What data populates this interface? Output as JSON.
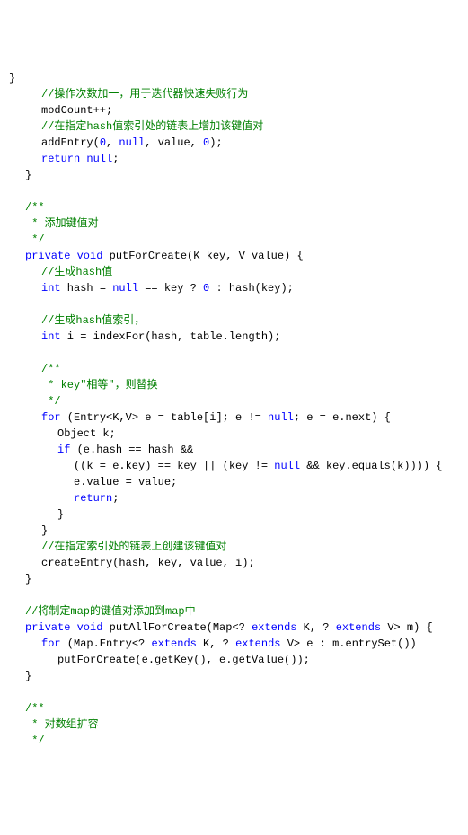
{
  "lines": [
    {
      "indent": 0,
      "spans": [
        {
          "t": "}",
          "c": "nm"
        }
      ]
    },
    {
      "indent": 2,
      "spans": [
        {
          "t": "//操作次数加一，用于迭代器快速失败行为",
          "c": "cm"
        }
      ]
    },
    {
      "indent": 2,
      "spans": [
        {
          "t": "modCount++;",
          "c": "nm"
        }
      ]
    },
    {
      "indent": 2,
      "spans": [
        {
          "t": "//在指定hash值索引处的链表上增加该键值对",
          "c": "cm"
        }
      ]
    },
    {
      "indent": 2,
      "spans": [
        {
          "t": "addEntry(",
          "c": "nm"
        },
        {
          "t": "0",
          "c": "kw"
        },
        {
          "t": ", ",
          "c": "nm"
        },
        {
          "t": "null",
          "c": "kw"
        },
        {
          "t": ", value, ",
          "c": "nm"
        },
        {
          "t": "0",
          "c": "kw"
        },
        {
          "t": ");",
          "c": "nm"
        }
      ]
    },
    {
      "indent": 2,
      "spans": [
        {
          "t": "return null",
          "c": "kw"
        },
        {
          "t": ";",
          "c": "nm"
        }
      ]
    },
    {
      "indent": 1,
      "spans": [
        {
          "t": "}",
          "c": "nm"
        }
      ]
    },
    {
      "indent": 0,
      "spans": [
        {
          "t": " ",
          "c": "nm"
        }
      ]
    },
    {
      "indent": 1,
      "spans": [
        {
          "t": "/**",
          "c": "cm"
        }
      ]
    },
    {
      "indent": 1,
      "spans": [
        {
          "t": " * 添加键值对",
          "c": "cm"
        }
      ]
    },
    {
      "indent": 1,
      "spans": [
        {
          "t": " */",
          "c": "cm"
        }
      ]
    },
    {
      "indent": 1,
      "spans": [
        {
          "t": "private void",
          "c": "kw"
        },
        {
          "t": " putForCreate(K key, V value) {",
          "c": "nm"
        }
      ]
    },
    {
      "indent": 2,
      "spans": [
        {
          "t": "//生成hash值",
          "c": "cm"
        }
      ]
    },
    {
      "indent": 2,
      "spans": [
        {
          "t": "int",
          "c": "kw"
        },
        {
          "t": " hash = ",
          "c": "nm"
        },
        {
          "t": "null",
          "c": "kw"
        },
        {
          "t": " == key ? ",
          "c": "nm"
        },
        {
          "t": "0",
          "c": "kw"
        },
        {
          "t": " : hash(key);",
          "c": "nm"
        }
      ]
    },
    {
      "indent": 0,
      "spans": [
        {
          "t": " ",
          "c": "nm"
        }
      ]
    },
    {
      "indent": 2,
      "spans": [
        {
          "t": "//生成hash值索引，",
          "c": "cm"
        }
      ]
    },
    {
      "indent": 2,
      "spans": [
        {
          "t": "int",
          "c": "kw"
        },
        {
          "t": " i = indexFor(hash, table.length);",
          "c": "nm"
        }
      ]
    },
    {
      "indent": 0,
      "spans": [
        {
          "t": " ",
          "c": "nm"
        }
      ]
    },
    {
      "indent": 2,
      "spans": [
        {
          "t": "/**",
          "c": "cm"
        }
      ]
    },
    {
      "indent": 2,
      "spans": [
        {
          "t": " * key\"相等\"，则替换",
          "c": "cm"
        }
      ]
    },
    {
      "indent": 2,
      "spans": [
        {
          "t": " */",
          "c": "cm"
        }
      ]
    },
    {
      "indent": 2,
      "spans": [
        {
          "t": "for",
          "c": "kw"
        },
        {
          "t": " (Entry<K,V> e = table[i]; e != ",
          "c": "nm"
        },
        {
          "t": "null",
          "c": "kw"
        },
        {
          "t": "; e = e.next) {",
          "c": "nm"
        }
      ]
    },
    {
      "indent": 3,
      "spans": [
        {
          "t": "Object k;",
          "c": "nm"
        }
      ]
    },
    {
      "indent": 3,
      "spans": [
        {
          "t": "if",
          "c": "kw"
        },
        {
          "t": " (e.hash == hash &&",
          "c": "nm"
        }
      ]
    },
    {
      "indent": 4,
      "spans": [
        {
          "t": "((k = e.key) == key || (key != ",
          "c": "nm"
        },
        {
          "t": "null",
          "c": "kw"
        },
        {
          "t": " && key.equals(k)))) {",
          "c": "nm"
        }
      ]
    },
    {
      "indent": 4,
      "spans": [
        {
          "t": "e.value = value;",
          "c": "nm"
        }
      ]
    },
    {
      "indent": 4,
      "spans": [
        {
          "t": "return",
          "c": "kw"
        },
        {
          "t": ";",
          "c": "nm"
        }
      ]
    },
    {
      "indent": 3,
      "spans": [
        {
          "t": "}",
          "c": "nm"
        }
      ]
    },
    {
      "indent": 2,
      "spans": [
        {
          "t": "}",
          "c": "nm"
        }
      ]
    },
    {
      "indent": 2,
      "spans": [
        {
          "t": "//在指定索引处的链表上创建该键值对",
          "c": "cm"
        }
      ]
    },
    {
      "indent": 2,
      "spans": [
        {
          "t": "createEntry(hash, key, value, i);",
          "c": "nm"
        }
      ]
    },
    {
      "indent": 1,
      "spans": [
        {
          "t": "}",
          "c": "nm"
        }
      ]
    },
    {
      "indent": 0,
      "spans": [
        {
          "t": " ",
          "c": "nm"
        }
      ]
    },
    {
      "indent": 1,
      "spans": [
        {
          "t": "//将制定map的键值对添加到map中",
          "c": "cm"
        }
      ]
    },
    {
      "indent": 1,
      "spans": [
        {
          "t": "private void",
          "c": "kw"
        },
        {
          "t": " putAllForCreate(Map<? ",
          "c": "nm"
        },
        {
          "t": "extends",
          "c": "kw"
        },
        {
          "t": " K, ? ",
          "c": "nm"
        },
        {
          "t": "extends",
          "c": "kw"
        },
        {
          "t": " V> m) {",
          "c": "nm"
        }
      ]
    },
    {
      "indent": 2,
      "spans": [
        {
          "t": "for",
          "c": "kw"
        },
        {
          "t": " (Map.Entry<? ",
          "c": "nm"
        },
        {
          "t": "extends",
          "c": "kw"
        },
        {
          "t": " K, ? ",
          "c": "nm"
        },
        {
          "t": "extends",
          "c": "kw"
        },
        {
          "t": " V> e : m.entrySet())",
          "c": "nm"
        }
      ]
    },
    {
      "indent": 3,
      "spans": [
        {
          "t": "putForCreate(e.getKey(), e.getValue());",
          "c": "nm"
        }
      ]
    },
    {
      "indent": 1,
      "spans": [
        {
          "t": "}",
          "c": "nm"
        }
      ]
    },
    {
      "indent": 0,
      "spans": [
        {
          "t": " ",
          "c": "nm"
        }
      ]
    },
    {
      "indent": 1,
      "spans": [
        {
          "t": "/**",
          "c": "cm"
        }
      ]
    },
    {
      "indent": 1,
      "spans": [
        {
          "t": " * 对数组扩容",
          "c": "cm"
        }
      ]
    },
    {
      "indent": 1,
      "spans": [
        {
          "t": " */",
          "c": "cm"
        }
      ]
    }
  ]
}
